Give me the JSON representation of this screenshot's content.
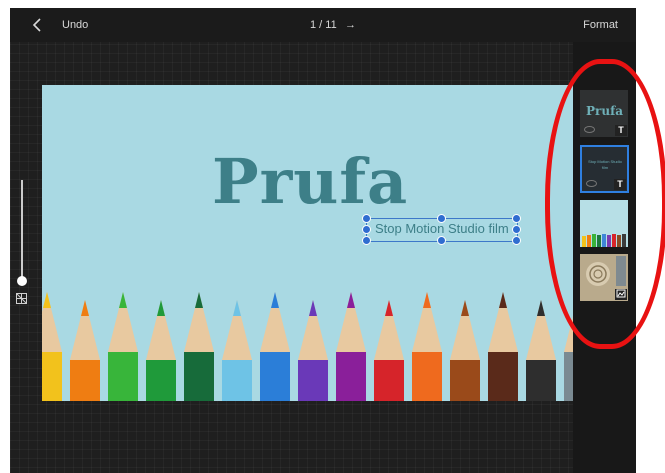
{
  "toolbar": {
    "back_icon": "chevron-left-icon",
    "undo_label": "Undo",
    "page_indicator": "1 / 11",
    "next_icon": "arrow-right-icon",
    "next_glyph": "→",
    "format_label": "Format"
  },
  "slide": {
    "title": "Prufa",
    "selected_text": "Stop Motion Studio film"
  },
  "zoom": {
    "grid_icon": "grid-icon"
  },
  "thumbnails": [
    {
      "kind": "title",
      "title": "Prufa",
      "badge": "T"
    },
    {
      "kind": "title",
      "title": "Stop Motion Studio film",
      "badge": "T",
      "selected": true
    },
    {
      "kind": "image",
      "subject": "pencils"
    },
    {
      "kind": "image",
      "subject": "shell",
      "badge_icon": "image-icon"
    }
  ],
  "colors": {
    "accent": "#2f7fe0",
    "slide_background": "#a9d9e3",
    "title_text": "#3d7f88",
    "annotation": "#e81212"
  }
}
